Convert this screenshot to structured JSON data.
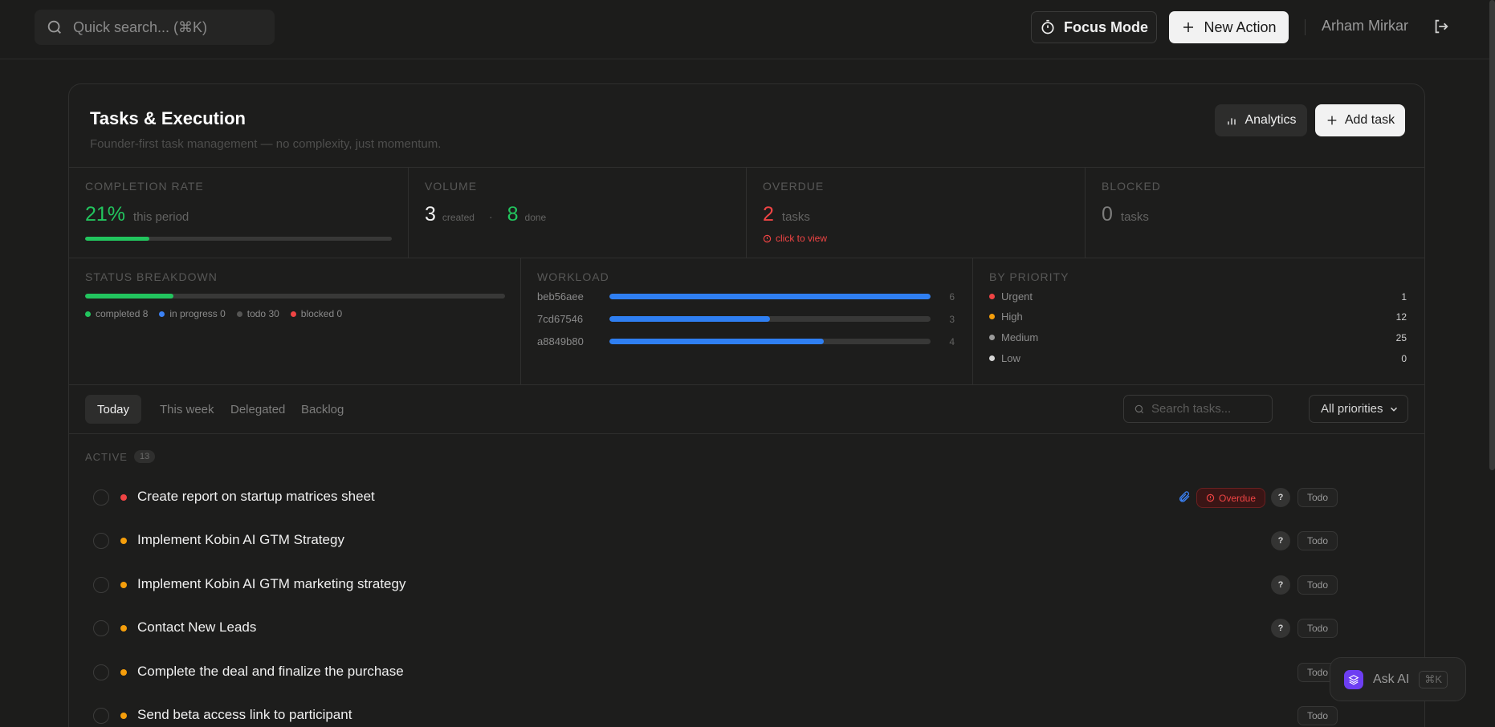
{
  "header": {
    "search_placeholder": "Quick search... (⌘K)",
    "focus_mode": "Focus Mode",
    "new_action": "New Action",
    "user_name": "Arham Mirkar"
  },
  "panel": {
    "title": "Tasks & Execution",
    "subtitle": "Founder-first task management — no complexity, just momentum.",
    "analytics": "Analytics",
    "add_task": "Add task"
  },
  "stats": {
    "completion": {
      "label": "COMPLETION RATE",
      "value": "21%",
      "unit": "this period",
      "progress": 0.21
    },
    "volume": {
      "label": "VOLUME",
      "created": "3",
      "created_label": "created",
      "sep": "·",
      "done": "8",
      "done_label": "done"
    },
    "overdue": {
      "label": "OVERDUE",
      "value": "2",
      "unit": "tasks",
      "link": "click to view"
    },
    "blocked": {
      "label": "BLOCKED",
      "value": "0",
      "unit": "tasks"
    }
  },
  "status_breakdown": {
    "label": "STATUS BREAKDOWN",
    "completed_fraction": 0.21,
    "legend": [
      "completed 8",
      "in progress 0",
      "todo 30",
      "blocked 0"
    ],
    "colors": [
      "#22c55e",
      "#3b82f6",
      "#555554",
      "#ef4444"
    ]
  },
  "workload": {
    "label": "WORKLOAD",
    "rows": [
      {
        "name": "beb56aee",
        "count": "6",
        "fraction": 1.0
      },
      {
        "name": "7cd67546",
        "count": "3",
        "fraction": 0.5
      },
      {
        "name": "a8849b80",
        "count": "4",
        "fraction": 0.667
      }
    ]
  },
  "priority": {
    "label": "BY PRIORITY",
    "rows": [
      {
        "name": "Urgent",
        "count": "1",
        "color": "#ef4444"
      },
      {
        "name": "High",
        "count": "12",
        "color": "#f59e0b"
      },
      {
        "name": "Medium",
        "count": "25",
        "color": "#9a9a9a"
      },
      {
        "name": "Low",
        "count": "0",
        "color": "#d6d6d6"
      }
    ]
  },
  "tabs": [
    "Today",
    "This week",
    "Delegated",
    "Backlog"
  ],
  "filters": {
    "search_placeholder": "Search tasks...",
    "priority_select": "All priorities"
  },
  "active": {
    "label": "ACTIVE",
    "count": "13"
  },
  "tasks": [
    {
      "title": "Create report on startup matrices sheet",
      "priority_color": "#ef4444",
      "overdue": "Overdue",
      "q": "?",
      "status": "Todo"
    },
    {
      "title": "Implement Kobin AI GTM Strategy",
      "priority_color": "#f59e0b",
      "q": "?",
      "status": "Todo"
    },
    {
      "title": "Implement Kobin AI GTM marketing strategy",
      "priority_color": "#f59e0b",
      "q": "?",
      "status": "Todo"
    },
    {
      "title": "Contact New Leads",
      "priority_color": "#f59e0b",
      "q": "?",
      "status": "Todo"
    },
    {
      "title": "Complete the deal and finalize the purchase",
      "priority_color": "#f59e0b",
      "status": "Todo"
    },
    {
      "title": "Send beta access link to participant",
      "priority_color": "#f59e0b",
      "status": "Todo"
    }
  ],
  "ask_ai": {
    "label": "Ask AI",
    "shortcut": "⌘K"
  }
}
